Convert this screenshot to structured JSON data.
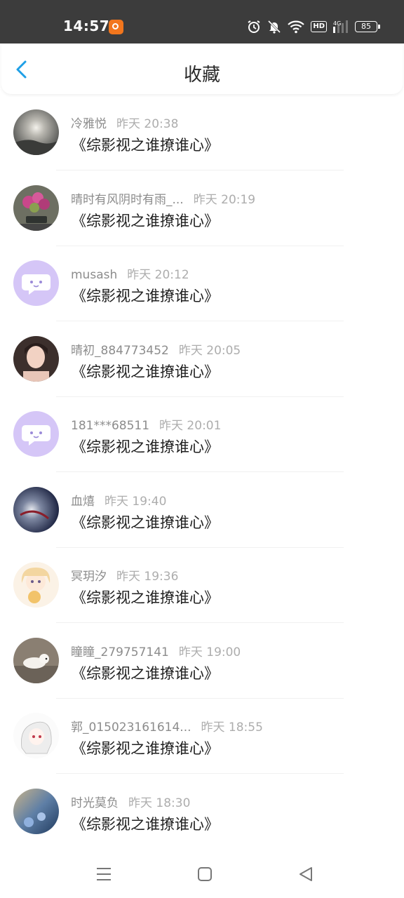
{
  "status_bar": {
    "time": "14:57",
    "battery": "85"
  },
  "header": {
    "title": "收藏"
  },
  "items": [
    {
      "user": "冷雅悦",
      "time": "昨天 20:38",
      "title": "《综影视之谁撩谁心》"
    },
    {
      "user": "晴时有风阴时有雨_...",
      "time": "昨天 20:19",
      "title": "《综影视之谁撩谁心》"
    },
    {
      "user": "musash",
      "time": "昨天 20:12",
      "title": "《综影视之谁撩谁心》"
    },
    {
      "user": "晴初_884773452",
      "time": "昨天 20:05",
      "title": "《综影视之谁撩谁心》"
    },
    {
      "user": "181***68511",
      "time": "昨天 20:01",
      "title": "《综影视之谁撩谁心》"
    },
    {
      "user": "血熺",
      "time": "昨天 19:40",
      "title": "《综影视之谁撩谁心》"
    },
    {
      "user": "冥玥汐",
      "time": "昨天 19:36",
      "title": "《综影视之谁撩谁心》"
    },
    {
      "user": "瞳瞳_279757141",
      "time": "昨天 19:00",
      "title": "《综影视之谁撩谁心》"
    },
    {
      "user": "郭_015023161614...",
      "time": "昨天 18:55",
      "title": "《综影视之谁撩谁心》"
    },
    {
      "user": "时光莫负",
      "time": "昨天 18:30",
      "title": "《综影视之谁撩谁心》"
    }
  ],
  "colors": {
    "accent": "#1e9fe6",
    "status_bar": "#3c3c3c",
    "default_avatar": "#d5c6f7"
  }
}
